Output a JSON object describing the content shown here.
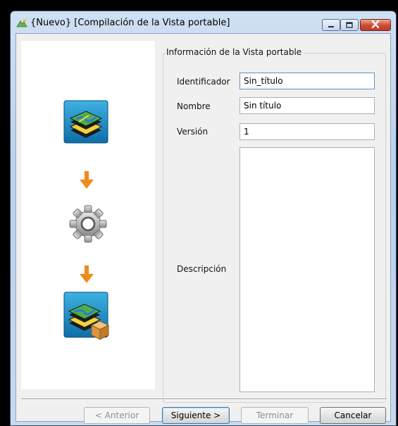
{
  "window": {
    "title": "{Nuevo} [Compilación de la Vista portable]",
    "icon": "app-map-icon",
    "controls": {
      "minimize": "minimize-icon",
      "maximize": "maximize-icon",
      "close": "close-icon"
    }
  },
  "illustration": {
    "steps": [
      "map-layers-icon",
      "arrow-down-icon",
      "gear-icon",
      "arrow-down-icon",
      "portable-package-icon"
    ]
  },
  "form": {
    "group_title": "Información de la Vista portable",
    "identifier": {
      "label": "Identificador",
      "value": "Sin_título"
    },
    "name": {
      "label": "Nombre",
      "value": "Sin título"
    },
    "version": {
      "label": "Versión",
      "value": "1"
    },
    "description": {
      "label": "Descripción",
      "value": ""
    }
  },
  "buttons": {
    "previous": "< Anterior",
    "next": "Siguiente >",
    "finish": "Terminar",
    "cancel": "Cancelar"
  },
  "colors": {
    "arrow": "#f08a1c",
    "tile": "#1b8fc9"
  }
}
